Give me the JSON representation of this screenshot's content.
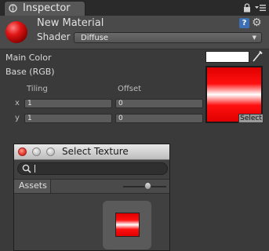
{
  "tab": {
    "label": "Inspector"
  },
  "material": {
    "name": "New Material",
    "shader_label": "Shader",
    "shader_value": "Diffuse",
    "help_glyph": "?",
    "gear_glyph": "⚙"
  },
  "properties": {
    "main_color_label": "Main Color",
    "main_color": "#ffffff",
    "base_label": "Base (RGB)",
    "tiling_label": "Tiling",
    "offset_label": "Offset",
    "x_label": "x",
    "y_label": "y",
    "tiling_x": "1",
    "tiling_y": "1",
    "offset_x": "0",
    "offset_y": "0",
    "select_label": "Select"
  },
  "select_texture_window": {
    "title": "Select Texture",
    "search_value": "",
    "assets_tab": "Assets",
    "zoom_level": 0.6
  },
  "icons": [
    "inspector-icon",
    "lock-icon",
    "tab-menu-icon",
    "help-icon",
    "gear-icon",
    "eyedropper-icon",
    "search-icon"
  ]
}
